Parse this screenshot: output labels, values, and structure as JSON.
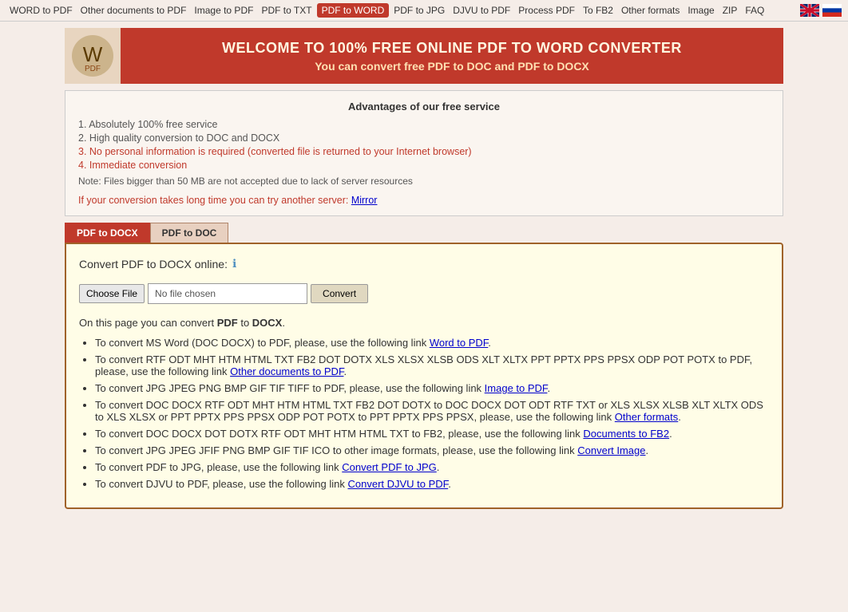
{
  "nav": {
    "items": [
      {
        "label": "WORD to PDF",
        "active": false,
        "id": "word-to-pdf"
      },
      {
        "label": "Other documents to PDF",
        "active": false,
        "id": "other-docs-to-pdf"
      },
      {
        "label": "Image to PDF",
        "active": false,
        "id": "image-to-pdf"
      },
      {
        "label": "PDF to TXT",
        "active": false,
        "id": "pdf-to-txt"
      },
      {
        "label": "PDF to WORD",
        "active": true,
        "id": "pdf-to-word"
      },
      {
        "label": "PDF to JPG",
        "active": false,
        "id": "pdf-to-jpg"
      },
      {
        "label": "DJVU to PDF",
        "active": false,
        "id": "djvu-to-pdf"
      },
      {
        "label": "Process PDF",
        "active": false,
        "id": "process-pdf"
      },
      {
        "label": "To FB2",
        "active": false,
        "id": "to-fb2"
      },
      {
        "label": "Other formats",
        "active": false,
        "id": "other-formats"
      },
      {
        "label": "Image",
        "active": false,
        "id": "image"
      },
      {
        "label": "ZIP",
        "active": false,
        "id": "zip"
      },
      {
        "label": "FAQ",
        "active": false,
        "id": "faq"
      }
    ]
  },
  "header": {
    "title": "WELCOME TO 100% FREE ONLINE PDF TO WORD CONVERTER",
    "subtitle": "You can convert free PDF to DOC and PDF to DOCX",
    "logo_icon": "🏠"
  },
  "advantages": {
    "title": "Advantages of our free service",
    "items": [
      {
        "text": "1. Absolutely 100% free service",
        "style": "normal"
      },
      {
        "text": "2. High quality conversion to DOC and DOCX",
        "style": "normal"
      },
      {
        "text": "3. No personal information is required (converted file is returned to your Internet browser)",
        "style": "red"
      },
      {
        "text": "4. Immediate conversion",
        "style": "red"
      }
    ],
    "note": "Note: Files bigger than 50 MB are not accepted due to lack of server resources",
    "mirror_text": "If your conversion takes long time you can try another server: ",
    "mirror_link_text": "Mirror"
  },
  "tabs": [
    {
      "label": "PDF to DOCX",
      "active": true
    },
    {
      "label": "PDF to DOC",
      "active": false
    }
  ],
  "converter": {
    "label": "Convert PDF to DOCX online:",
    "choose_file_label": "Choose File",
    "no_file_text": "No file chosen",
    "convert_label": "Convert"
  },
  "description": {
    "intro_before": "On this page you can convert ",
    "pdf_text": "PDF",
    "to_text": " to ",
    "docx_text": "DOCX",
    "intro_after": ".",
    "bullets": [
      {
        "text_before": "To convert MS Word (DOC DOCX) to PDF, please, use the following link ",
        "link_text": "Word to PDF",
        "text_after": "."
      },
      {
        "text_before": "To convert RTF ODT MHT HTM HTML TXT FB2 DOT DOTX XLS XLSX XLSB ODS XLT XLTX PPT PPTX PPS PPSX ODP POT POTX to PDF, please, use the following link ",
        "link_text": "Other documents to PDF",
        "text_after": "."
      },
      {
        "text_before": "To convert JPG JPEG PNG BMP GIF TIF TIFF to PDF, please, use the following link ",
        "link_text": "Image to PDF",
        "text_after": "."
      },
      {
        "text_before": "To convert DOC DOCX RTF ODT MHT HTM HTML TXT FB2 DOT DOTX to DOC DOCX DOT ODT RTF TXT or XLS XLSX XLSB XLT XLTX ODS to XLS XLSX or PPT PPTX PPS PPSX ODP POT POTX to PPT PPTX PPS PPSX, please, use the following link ",
        "link_text": "Other formats",
        "text_after": "."
      },
      {
        "text_before": "To convert DOC DOCX DOT DOTX RTF ODT MHT HTM HTML TXT to FB2, please, use the following link ",
        "link_text": "Documents to FB2",
        "text_after": "."
      },
      {
        "text_before": "To convert JPG JPEG JFIF PNG BMP GIF TIF ICO to other image formats, please, use the following link ",
        "link_text": "Convert Image",
        "text_after": "."
      },
      {
        "text_before": "To convert PDF to JPG, please, use the following link ",
        "link_text": "Convert PDF to JPG",
        "text_after": "."
      },
      {
        "text_before": "To convert DJVU to PDF, please, use the following link ",
        "link_text": "Convert DJVU to PDF",
        "text_after": "."
      }
    ]
  }
}
